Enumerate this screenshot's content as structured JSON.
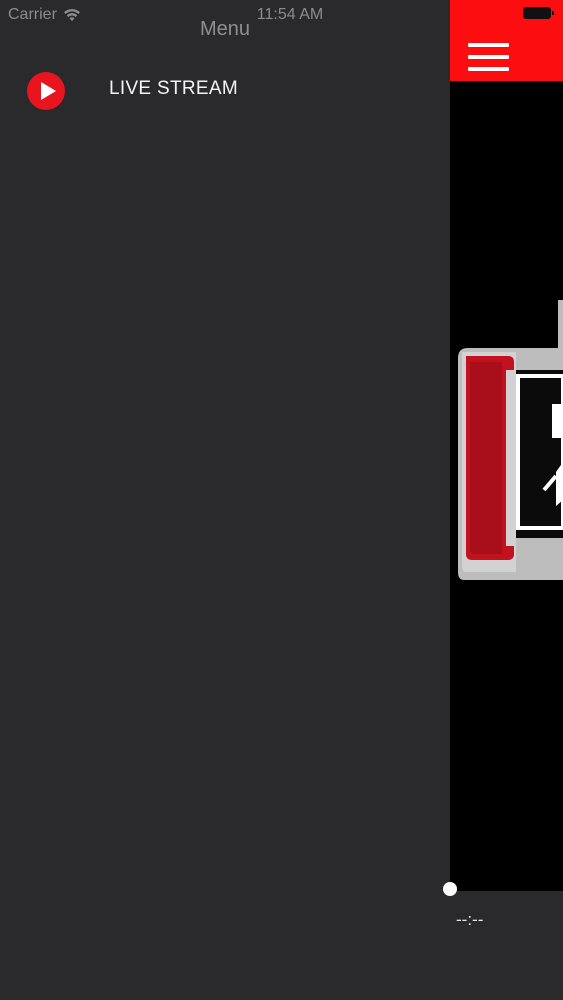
{
  "status_bar": {
    "carrier": "Carrier",
    "time": "11:54 AM"
  },
  "menu": {
    "title": "Menu",
    "items": [
      {
        "label": "LIVE STREAM",
        "icon": "play-circle-icon",
        "icon_color": "#e8151f"
      }
    ]
  },
  "main": {
    "header_color": "#fc0d10",
    "menu_icon": "hamburger-icon",
    "player": {
      "time_display": "--:--",
      "progress": 0
    }
  },
  "colors": {
    "drawer_background": "#2a292b",
    "main_background": "#000000",
    "accent": "#fc0d10"
  }
}
